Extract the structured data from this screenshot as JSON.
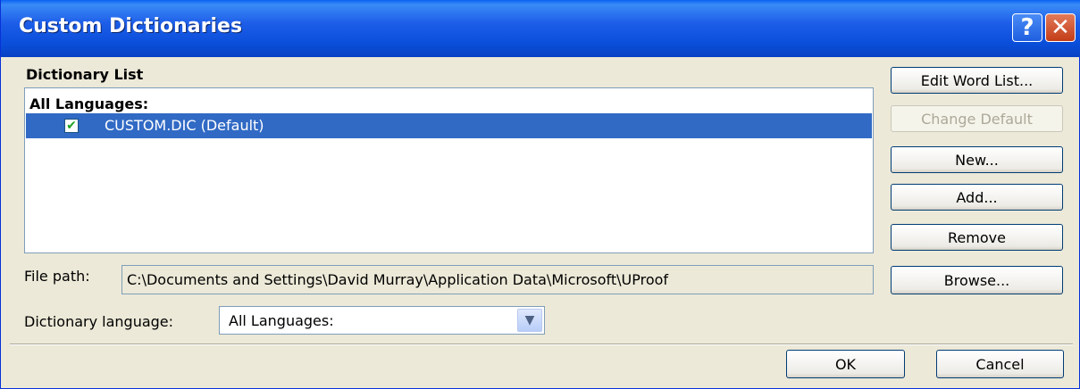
{
  "window": {
    "title": "Custom Dictionaries",
    "help_glyph": "?",
    "close_glyph": "✕"
  },
  "dictionary_list": {
    "label": "Dictionary List",
    "group_header": "All Languages:",
    "items": [
      {
        "label": "CUSTOM.DIC (Default)",
        "checked": true,
        "selected": true
      }
    ]
  },
  "buttons": {
    "edit_word_list": "Edit Word List...",
    "change_default": "Change Default",
    "new": "New...",
    "add": "Add...",
    "remove": "Remove",
    "browse": "Browse...",
    "ok": "OK",
    "cancel": "Cancel"
  },
  "file_path": {
    "label": "File path:",
    "value": "C:\\Documents and Settings\\David Murray\\Application Data\\Microsoft\\UProof"
  },
  "dictionary_language": {
    "label": "Dictionary language:",
    "selected": "All Languages:"
  },
  "colors": {
    "titlebar": "#0a4fdb",
    "selection": "#316ac5",
    "dialog_bg": "#ece9d8"
  }
}
